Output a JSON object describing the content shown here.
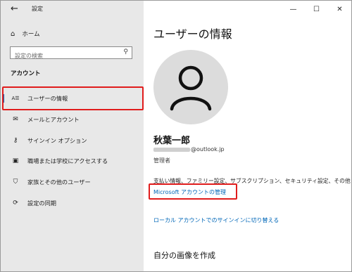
{
  "window": {
    "title": "設定",
    "back_glyph": "←",
    "controls": {
      "minimize": "—",
      "maximize": "☐",
      "close": "✕"
    }
  },
  "sidebar": {
    "home_label": "ホーム",
    "home_icon": "⌂",
    "search_placeholder": "設定の検索",
    "search_icon": "⚲",
    "section_title": "アカウント",
    "items": [
      {
        "label": "ユーザーの情報",
        "icon": "person-list-icon",
        "glyph": "A☰"
      },
      {
        "label": "メールとアカウント",
        "icon": "mail-icon",
        "glyph": "✉"
      },
      {
        "label": "サインイン オプション",
        "icon": "key-icon",
        "glyph": "⚷"
      },
      {
        "label": "職場または学校にアクセスする",
        "icon": "briefcase-icon",
        "glyph": "▣"
      },
      {
        "label": "家族とその他のユーザー",
        "icon": "person-add-icon",
        "glyph": "⛉"
      },
      {
        "label": "設定の同期",
        "icon": "sync-icon",
        "glyph": "⟳"
      }
    ],
    "highlight_color": "#e01c1c",
    "accent_color": "#0067c0"
  },
  "main": {
    "title": "ユーザーの情報",
    "user_name": "秋葉一郎",
    "email_suffix": "@outlook.jp",
    "role": "管理者",
    "description": "支払い情報、ファミリー設定、サブスクリプション、セキュリティ設定、その他",
    "manage_link": "Microsoft アカウントの管理",
    "local_link": "ローカル アカウントでのサインインに切り替える",
    "section2_title": "自分の画像を作成",
    "link_color": "#0067b8"
  }
}
